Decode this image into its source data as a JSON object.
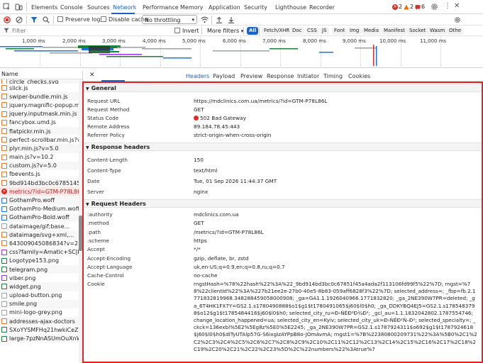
{
  "tabbar": {
    "tabs": [
      "Elements",
      "Console",
      "Sources",
      "Network",
      "Performance",
      "Memory",
      "Application",
      "Security",
      "Lighthouse",
      "Recorder"
    ],
    "active": "Network",
    "errors": "2",
    "warnings": "2",
    "issues": "6"
  },
  "toolbar": {
    "preserve_log": "Preserve log",
    "disable_cache": "Disable cache",
    "throttle": "No throttling"
  },
  "filterbar": {
    "placeholder": "Filter",
    "invert": "Invert",
    "more_filters": "More filters",
    "types": [
      "All",
      "Fetch/XHR",
      "Doc",
      "CSS",
      "JS",
      "Font",
      "Img",
      "Media",
      "Manifest",
      "Socket",
      "Wasm",
      "Othe"
    ],
    "active_type": "All"
  },
  "timeline": {
    "ticks": [
      "1,000 ms",
      "2,000 ms",
      "3,000 ms",
      "4,000 ms",
      "5,000 ms",
      "6,000 ms",
      "7,000 ms",
      "8,000 ms",
      "9,000 ms",
      "10,000 ms",
      "11,000 ms"
    ]
  },
  "list": {
    "header": "Name",
    "items": [
      {
        "name": "circle_checks.svg",
        "color": "#e9772b"
      },
      {
        "name": "slick.js",
        "color": "#e9772b"
      },
      {
        "name": "swiper-bundle.min.js",
        "color": "#e9772b"
      },
      {
        "name": "jquery.magnific-popup.min.js",
        "color": "#e9772b"
      },
      {
        "name": "jquery.inputmask.min.js",
        "color": "#e9772b"
      },
      {
        "name": "fancybox.umd.js",
        "color": "#e9772b"
      },
      {
        "name": "flatpickr.min.js",
        "color": "#e9772b"
      },
      {
        "name": "perfect-scrollbar.min.js?v=5.0",
        "color": "#e9772b"
      },
      {
        "name": "plyr.min.js?v=5.0",
        "color": "#e9772b"
      },
      {
        "name": "main.js?v=10.2",
        "color": "#e9772b"
      },
      {
        "name": "custom.js?v=5.0",
        "color": "#e9772b"
      },
      {
        "name": "fbevents.js",
        "color": "#e9772b"
      },
      {
        "name": "9bd914bd3bc0c6785145a4...",
        "color": "#e9772b"
      },
      {
        "name": "metrics/?id=GTM-P78L86L",
        "color": "#d93025",
        "selected": true
      },
      {
        "name": "GothamPro.woff",
        "color": "#1a73e8"
      },
      {
        "name": "GothamPro-Medium.woff",
        "color": "#1a73e8"
      },
      {
        "name": "GothamPro-Bold.woff",
        "color": "#1a73e8"
      },
      {
        "name": "dataimage/gif;base...",
        "color": "#9aa0a6"
      },
      {
        "name": "dataimage/svg+xml,...",
        "color": "#e9772b"
      },
      {
        "name": "643009045086834?v=2.9.39...",
        "color": "#e9772b"
      },
      {
        "name": "css?family=Amatic+SC|Lobs...",
        "color": "#9334e6"
      },
      {
        "name": "Logotype153.png",
        "color": "#188038"
      },
      {
        "name": "telegram.png",
        "color": "#188038"
      },
      {
        "name": "viber.png",
        "color": "#9334e6"
      },
      {
        "name": "widget.png",
        "color": "#188038"
      },
      {
        "name": "upload-button.png",
        "color": "#9aa0a6"
      },
      {
        "name": "smile.png",
        "color": "#9aa0a6"
      },
      {
        "name": "mini-logo-grey.png",
        "color": "#9aa0a6"
      },
      {
        "name": "addresses-ajax-doctors",
        "color": "#e9772b"
      },
      {
        "name": "SXoYYSMFHq21hwkiCeZi22...",
        "color": "#188038"
      },
      {
        "name": "large-7pzNnASUmOuXnWp...",
        "color": "#188038"
      }
    ]
  },
  "panel": {
    "tabs": [
      "Headers",
      "Payload",
      "Preview",
      "Response",
      "Initiator",
      "Timing",
      "Cookies"
    ],
    "active": "Headers"
  },
  "general": {
    "title": "General",
    "rows": [
      {
        "k": "Request URL",
        "v": "https://mdclinics.com.ua/metrics/?id=GTM-P78L86L"
      },
      {
        "k": "Request Method",
        "v": "GET"
      },
      {
        "k": "Status Code",
        "v": "502 Bad Gateway"
      },
      {
        "k": "Remote Address",
        "v": "89.184.78.45:443"
      },
      {
        "k": "Referrer Policy",
        "v": "strict-origin-when-cross-origin"
      }
    ],
    "status_color": "#d93025"
  },
  "response_headers": {
    "title": "Response headers",
    "rows": [
      {
        "k": "Content-Length",
        "v": "150"
      },
      {
        "k": "Content-Type",
        "v": "text/html"
      },
      {
        "k": "Date",
        "v": "Tue, 01 Sep 2026 11:44:37 GMT"
      },
      {
        "k": "Server",
        "v": "nginx"
      }
    ]
  },
  "request_headers": {
    "title": "Request Headers",
    "rows": [
      {
        "k": ":authority",
        "v": "mdclinics.com.ua"
      },
      {
        "k": ":method",
        "v": "GET"
      },
      {
        "k": ":path",
        "v": "/metrics/?id=GTM-P78L86L"
      },
      {
        "k": ":scheme",
        "v": "https"
      },
      {
        "k": "Accept",
        "v": "*/*"
      },
      {
        "k": "Accept-Encoding",
        "v": "gzip, deflate, br, zstd"
      },
      {
        "k": "Accept-Language",
        "v": "uk,en-US;q=0.9,en;q=0.8,ru;q=0.7"
      },
      {
        "k": "Cache-Control",
        "v": "no-cache"
      }
    ],
    "cookie_key": "Cookie",
    "cookie_value": "rngstHash=%78%22hash%22%3A%22_9bd914bd3bc0c67851f45a4ada2f113106fd99f5%22%7D; rngst=%78%22clientId%22%3A%227b21ee2e-27b0-40e5-8b83-059aff6828f3%22%7D; selected_address=; _fbp=fb.2.1771832819968.348288459058000908; _ga=GA1.1.1926040966.1771832820; _ga_2NE390W7PR=deleted; _ga_6T4HK1FX7Y=GS2.1.s1780490888$o1$g1$t1780491065$j60$l0$h0; _ga_DDKYBQ4EJ5=GS2.1.s1785483798$o12$g1$t1785484416$j60$l0$h0; selected_city_ru=Đ›ŇĚĐ²Đ¾Đ²; _gcl_au=1.1.1832042802.1787554746; change_location_happened=ua; selected_city_en=Kyiv; selected_city_uk=Đ›ŇĚĐ²Ň–Đ²; selected_specialty=; _ckck=136exbl%5E2%5Eg8z%5E0%5E2245; _ga_2NE390W7PR=GS2.1.s1787924311$o692$g1$t1787924618$j60$l0$h0$dITyUTAlp57G-S6ixgIzAYPpB8o-JOmAvmA; rngst1=%7B%22380800209731%22%3A%5B0%2C1%2C2%2C3%2C4%2C5%2C6%2C7%2C8%2C9%2C10%2C11%2C12%2C13%2C14%2C15%2C16%2C17%2C18%2C19%2C20%2C21%2C22%2C23%5D%2C%22numbers%22%3Atrue%7"
  },
  "colors": {
    "accent": "#1a62c7",
    "highlight_border": "#e32222",
    "error": "#d93025",
    "warning": "#e37400"
  }
}
